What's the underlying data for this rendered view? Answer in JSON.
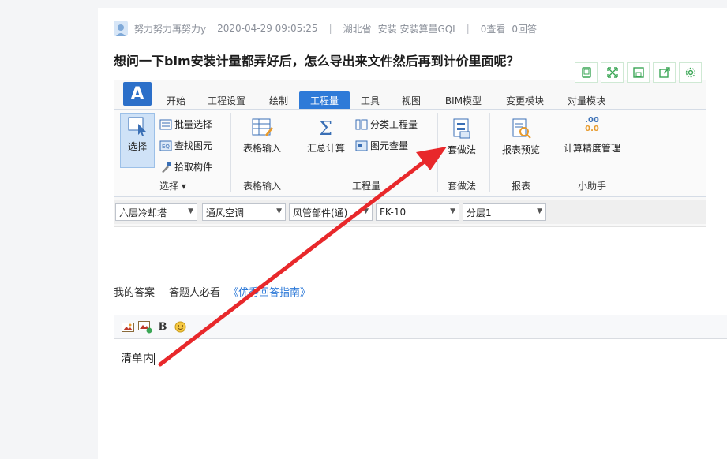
{
  "meta": {
    "author": "努力努力再努力y",
    "timestamp": "2020-04-29 09:05:25",
    "separator": "|",
    "location": "湖北省",
    "tags": "安装 安装算量GQI",
    "views": "0查看",
    "answers": "0回答"
  },
  "question_title": "想问一下bim安装计量都弄好后，怎么导出来文件然后再到计价里面呢？",
  "image_tools": [
    "mobile-icon",
    "expand-icon",
    "save-icon",
    "share-icon",
    "settings-icon"
  ],
  "screenshot": {
    "logo": "A",
    "tabs": [
      "开始",
      "工程设置",
      "绘制",
      "工程量",
      "工具",
      "视图",
      "BIM模型",
      "变更模块",
      "对量模块"
    ],
    "active_tab": "工程量",
    "select_group": {
      "big": "选择",
      "items": [
        "批量选择",
        "查找图元",
        "拾取构件"
      ],
      "label": "选择 ▾"
    },
    "table_group": {
      "big": "表格输入",
      "label": "表格输入"
    },
    "quantity_group": {
      "big": "汇总计算",
      "items": [
        "分类工程量",
        "图元查量"
      ],
      "label": "工程量"
    },
    "method_group": {
      "big": "套做法",
      "label": "套做法"
    },
    "report_group": {
      "big": "报表预览",
      "label": "报表"
    },
    "helper_group": {
      "big": "计算精度管理",
      "label": "小助手",
      "icon_text_top": ".00",
      "icon_text_bottom": "0.0"
    },
    "dropdowns": [
      "六层冷却塔",
      "通风空调",
      "风管部件(通)",
      "FK-10",
      "分层1"
    ]
  },
  "answer_tabs": {
    "my_answer": "我的答案",
    "must_read": "答题人必看",
    "guide_link": "《优秀回答指南》"
  },
  "editor": {
    "tools": [
      "image-icon",
      "gallery-icon",
      "bold-button",
      "emoji-icon"
    ],
    "bold_label": "B",
    "content": "清单内"
  },
  "colors": {
    "accent": "#2e7ad8",
    "arrow": "#e8282b",
    "icon_green": "#3aa655"
  }
}
